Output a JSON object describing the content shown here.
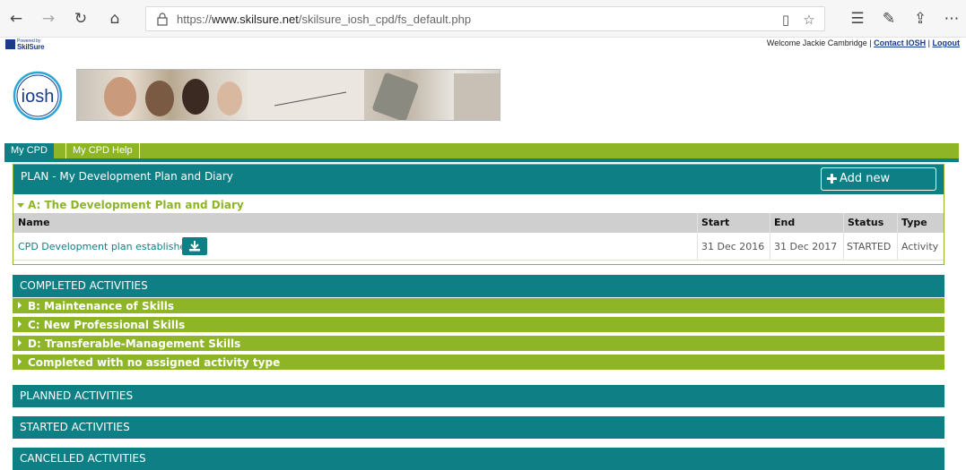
{
  "browser": {
    "url_prefix": "https://",
    "url_domain": "www.skilsure.net",
    "url_path": "/skilsure_iosh_cpd/fs_default.php"
  },
  "header": {
    "powered_by": "Powered by",
    "powered_logo": "SkilSure",
    "welcome": "Welcome Jackie Cambridge |",
    "contact": "Contact IOSH",
    "sep": "|",
    "logout": "Logout",
    "logo_text": "iosh"
  },
  "tabs": [
    {
      "label": "My CPD"
    },
    {
      "label": "My CPD Help"
    }
  ],
  "plan": {
    "title": "PLAN - My Development Plan and Diary",
    "add_label": "Add new activity",
    "section_a": "A: The Development Plan and Diary",
    "columns": [
      "Name",
      "Start",
      "End",
      "Status",
      "Type"
    ],
    "row": {
      "name": "CPD Development plan established",
      "start": "31 Dec 2016",
      "end": "31 Dec 2017",
      "status": "STARTED",
      "type": "Activity"
    }
  },
  "completed": {
    "title": "COMPLETED ACTIVITIES",
    "items": [
      "B: Maintenance of Skills",
      "C: New Professional Skills",
      "D: Transferable-Management Skills",
      "Completed with no assigned activity type"
    ]
  },
  "planned": {
    "title": "PLANNED ACTIVITIES"
  },
  "started": {
    "title": "STARTED ACTIVITIES"
  },
  "cancelled": {
    "title": "CANCELLED ACTIVITIES"
  },
  "colors": {
    "teal": "#0f7f86",
    "green": "#8db526"
  }
}
